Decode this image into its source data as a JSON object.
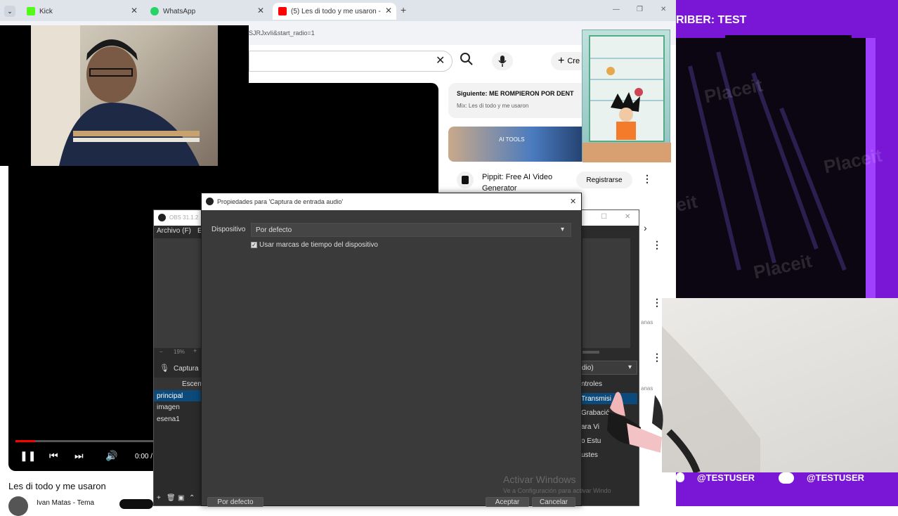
{
  "browser": {
    "tabs": [
      {
        "label": "Kick",
        "favicon_color": "#53fc18",
        "close": "✕"
      },
      {
        "label": "WhatsApp",
        "favicon_color": "#25d366",
        "close": "✕"
      },
      {
        "label": "(5) Les di todo y me usaron - Y",
        "favicon_color": "#ff0000",
        "close": "✕"
      }
    ],
    "new_tab": "+",
    "url_fragment": "SJRJxvIi&start_radio=1",
    "window_controls": [
      "—",
      "❐",
      "✕"
    ]
  },
  "youtube": {
    "create_label": "Cre",
    "up_next_label": "Siguiente: ME ROMPIERON POR DENT",
    "mix_label": "Mix: Les di todo y me usaron",
    "ad_image_text": "AI TOOLS",
    "ad_title_line1": "Pippit: Free AI Video",
    "ad_title_line2": "Generator",
    "ad_button": "Registrarse",
    "video_title": "Les di todo y me usaron",
    "channel": "Ivan Matas - Tema",
    "time": "0:00 /",
    "side_snippets": [
      "anas",
      "anas"
    ]
  },
  "stream_overlay": {
    "subscriber_text": "RIBER: TEST",
    "watermarks": [
      "Placeit",
      "Placeit",
      "eit",
      "Placeit"
    ],
    "handle_left": "@TESTUSER",
    "handle_right": "@TESTUSER"
  },
  "obs": {
    "title": "OBS 31.1.2",
    "menu_file": "Archivo (F)",
    "menu_edit": "E",
    "zoom": "19%",
    "source_label": "Captura",
    "scenes_header": "Escena",
    "scenes": [
      "principal",
      "imagen",
      "esena1"
    ],
    "audio_dropdown": "dio)",
    "controls_header": "ntroles",
    "controls": [
      "Transmisi",
      "Grabació",
      "ara Vi",
      "o Estu",
      "ustes"
    ],
    "bottom_icons": [
      "+",
      "🗑",
      "▣",
      "⌃"
    ]
  },
  "dialog": {
    "title": "Propiedades para 'Captura de entrada audio'",
    "device_label": "Dispositivo",
    "device_value": "Por defecto",
    "checkbox_label": "Usar marcas de tiempo del dispositivo",
    "checkbox_checked": true,
    "defaults_button": "Por defecto",
    "ok_button": "Aceptar",
    "cancel_button": "Cancelar"
  },
  "windows_watermark": {
    "line1": "Activar Windows",
    "line2": "Ve a Configuración para activar Windo"
  },
  "colors": {
    "stream_purple": "#7a17d6",
    "obs_dark": "#2b2b2b",
    "dialog_bg": "#3a3a3a",
    "selection_blue": "#0b4a7a"
  }
}
